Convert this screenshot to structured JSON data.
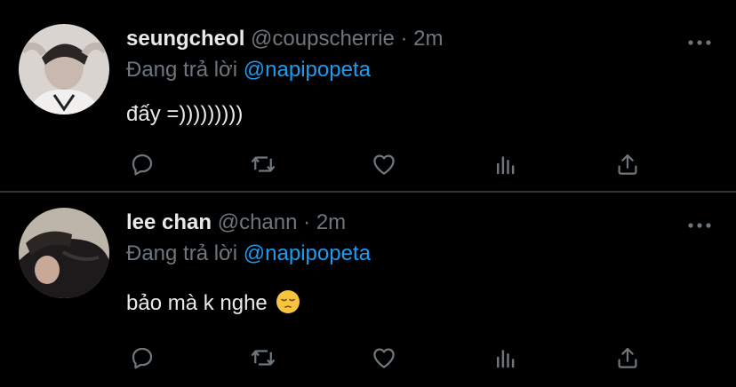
{
  "tweets": [
    {
      "display_name": "seungcheol",
      "handle": "@coupscherrie",
      "separator": "·",
      "time": "2m",
      "replying_prefix": "Đang trả lời",
      "replying_to": "@napipopeta",
      "text": "đấy =)))))))))",
      "avatar": "avatar-photo-seungcheol"
    },
    {
      "display_name": "lee chan",
      "handle": "@chann",
      "separator": "·",
      "time": "2m",
      "replying_prefix": "Đang trả lời",
      "replying_to": "@napipopeta",
      "text": "bảo mà k nghe",
      "emoji": "pensive-face-emoji",
      "avatar": "avatar-photo-lee-chan"
    }
  ],
  "action_icons": [
    "reply-icon",
    "retweet-icon",
    "like-icon",
    "analytics-icon",
    "share-icon"
  ],
  "colors": {
    "background": "#000000",
    "text": "#e7e9ea",
    "secondary": "#6e767d",
    "mention": "#1d9bf0",
    "divider": "#2f3336"
  }
}
